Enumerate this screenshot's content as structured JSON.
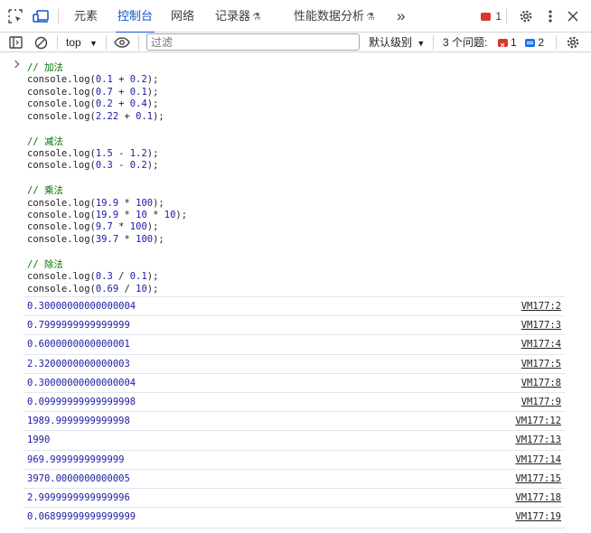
{
  "tabs": [
    {
      "label": "元素",
      "active": false
    },
    {
      "label": "控制台",
      "active": true
    },
    {
      "label": "网络",
      "active": false
    },
    {
      "label": "记录器",
      "active": false
    },
    {
      "label": "性能数据分析",
      "active": false
    }
  ],
  "tabbar": {
    "more_tabs": "»",
    "error_count": "1"
  },
  "toolbar": {
    "context": "top",
    "filter_placeholder": "过滤",
    "levels": "默认级别",
    "issues_label": "3 个问题:",
    "issues_errors": "1",
    "issues_info": "2"
  },
  "code_lines": [
    {
      "kind": "comment",
      "text": "// 加法"
    },
    {
      "kind": "log",
      "a": "0.1",
      "op": "+",
      "b": "0.2"
    },
    {
      "kind": "log",
      "a": "0.7",
      "op": "+",
      "b": "0.1"
    },
    {
      "kind": "log",
      "a": "0.2",
      "op": "+",
      "b": "0.4"
    },
    {
      "kind": "log",
      "a": "2.22",
      "op": "+",
      "b": "0.1"
    },
    {
      "kind": "blank"
    },
    {
      "kind": "comment",
      "text": "// 减法"
    },
    {
      "kind": "log",
      "a": "1.5",
      "op": "-",
      "b": "1.2"
    },
    {
      "kind": "log",
      "a": "0.3",
      "op": "-",
      "b": "0.2"
    },
    {
      "kind": "blank"
    },
    {
      "kind": "comment",
      "text": "// 乘法"
    },
    {
      "kind": "log",
      "a": "19.9",
      "op": "*",
      "b": "100"
    },
    {
      "kind": "log3",
      "a": "19.9",
      "op": "*",
      "b": "10",
      "op2": "*",
      "c": "10"
    },
    {
      "kind": "log",
      "a": "9.7",
      "op": "*",
      "b": "100"
    },
    {
      "kind": "log",
      "a": "39.7",
      "op": "*",
      "b": "100"
    },
    {
      "kind": "blank"
    },
    {
      "kind": "comment",
      "text": "// 除法"
    },
    {
      "kind": "log",
      "a": "0.3",
      "op": "/",
      "b": "0.1"
    },
    {
      "kind": "log",
      "a": "0.69",
      "op": "/",
      "b": "10"
    }
  ],
  "outputs": [
    {
      "value": "0.30000000000000004",
      "source": "VM177:2"
    },
    {
      "value": "0.7999999999999999",
      "source": "VM177:3"
    },
    {
      "value": "0.6000000000000001",
      "source": "VM177:4"
    },
    {
      "value": "2.3200000000000003",
      "source": "VM177:5"
    },
    {
      "value": "0.30000000000000004",
      "source": "VM177:8"
    },
    {
      "value": "0.09999999999999998",
      "source": "VM177:9"
    },
    {
      "value": "1989.9999999999998",
      "source": "VM177:12"
    },
    {
      "value": "1990",
      "source": "VM177:13"
    },
    {
      "value": "969.9999999999999",
      "source": "VM177:14"
    },
    {
      "value": "3970.0000000000005",
      "source": "VM177:15"
    },
    {
      "value": "2.9999999999999996",
      "source": "VM177:18"
    },
    {
      "value": "0.06899999999999999",
      "source": "VM177:19"
    }
  ],
  "colors": {
    "accent": "#0b57d0",
    "error": "#dc362e",
    "info": "#1a73e8",
    "number": "#1a1aa6",
    "comment": "#007400"
  }
}
